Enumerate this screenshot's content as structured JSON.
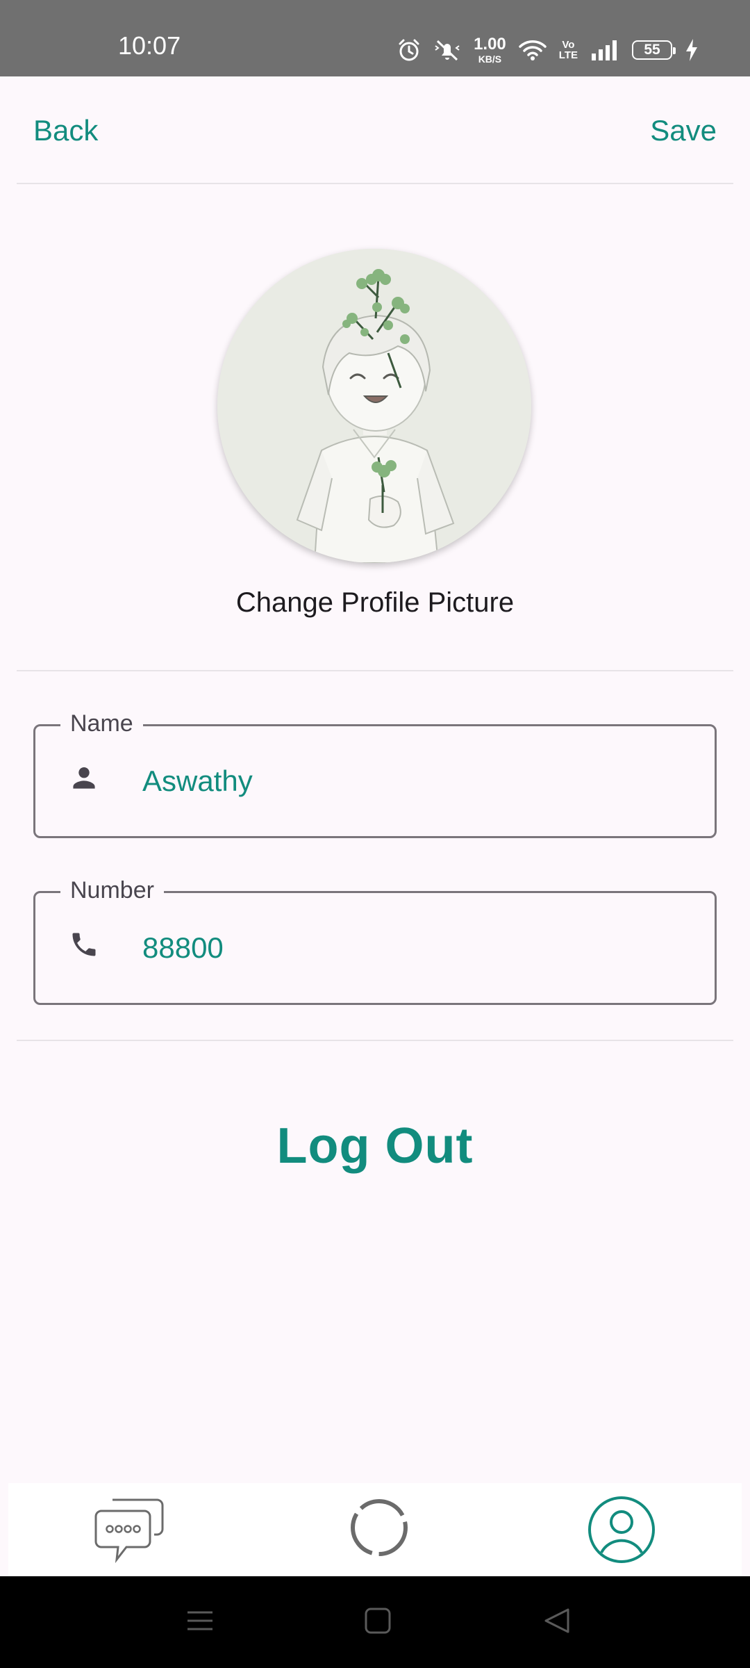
{
  "status_bar": {
    "time": "10:07",
    "net_speed_value": "1.00",
    "net_speed_unit": "KB/S",
    "volte_top": "Vo",
    "volte_bottom": "LTE",
    "battery_level": "55",
    "icons": [
      "alarm-icon",
      "mute-icon",
      "wifi-icon",
      "signal-icon",
      "battery-icon",
      "charging-icon"
    ]
  },
  "header": {
    "back_label": "Back",
    "save_label": "Save"
  },
  "profile": {
    "change_picture_label": "Change Profile Picture"
  },
  "form": {
    "name_label": "Name",
    "name_value": "Aswathy",
    "number_label": "Number",
    "number_value": "88800"
  },
  "logout_label": "Log Out",
  "bottom_nav": {
    "items": [
      "chats-icon",
      "status-icon",
      "profile-icon"
    ],
    "active": "profile-icon"
  },
  "system_nav": [
    "menu-icon",
    "home-icon",
    "back-icon"
  ],
  "colors": {
    "accent": "#128c7e",
    "background": "#fdf8fc",
    "status_bar": "#707070"
  }
}
